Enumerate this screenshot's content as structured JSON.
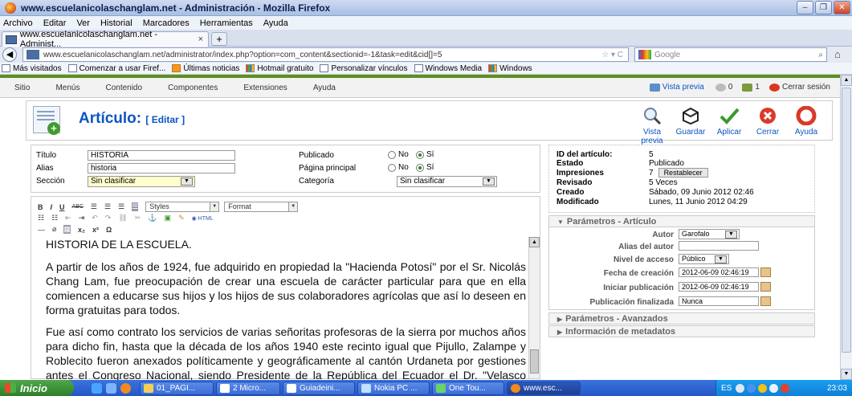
{
  "window": {
    "title": "www.escuelanicolaschanglam.net - Administración - Mozilla Firefox"
  },
  "menubar": [
    "Archivo",
    "Editar",
    "Ver",
    "Historial",
    "Marcadores",
    "Herramientas",
    "Ayuda"
  ],
  "tab": {
    "label": "www.escuelanicolaschanglam.net - Administ...",
    "close": "×",
    "new_tab": "+"
  },
  "address": {
    "url": "www.escuelanicolaschanglam.net/administrator/index.php?option=com_content&sectionid=-1&task=edit&cid[]=5",
    "search_placeholder": "Google"
  },
  "bookmarks": [
    "Más visitados",
    "Comenzar a usar Firef...",
    "Últimas noticias",
    "Hotmail gratuito",
    "Personalizar vínculos",
    "Windows Media",
    "Windows"
  ],
  "admin_menu": {
    "items": [
      "Sitio",
      "Menús",
      "Contenido",
      "Componentes",
      "Extensiones",
      "Ayuda"
    ],
    "preview": "Vista previa",
    "count_a": "0",
    "count_b": "1",
    "logout": "Cerrar sesión"
  },
  "header": {
    "title": "Artículo:",
    "subtitle": "[ Editar ]",
    "toolbar": [
      "Vista previa",
      "Guardar",
      "Aplicar",
      "Cerrar",
      "Ayuda"
    ]
  },
  "form": {
    "titulo_label": "Título",
    "titulo_value": "HISTORIA",
    "alias_label": "Alias",
    "alias_value": "historia",
    "seccion_label": "Sección",
    "seccion_value": "Sin clasificar",
    "publicado_label": "Publicado",
    "pagina_label": "Página principal",
    "categoria_label": "Categoría",
    "categoria_value": "Sin clasificar",
    "no": "No",
    "si": "Sí"
  },
  "editor": {
    "styles": "Styles",
    "format": "Format",
    "heading": "HISTORIA DE LA ESCUELA.",
    "p1": "A partir de los años de 1924, fue adquirido en propiedad la \"Hacienda Potosí\" por el Sr. Nicolás Chang Lam, fue preocupación de crear una escuela de carácter particular para que en ella comiencen a educarse sus hijos y los hijos de sus colaboradores agrícolas que así lo deseen en forma gratuitas para todos.",
    "p2": "Fue así como contrato los servicios de varias señoritas profesoras de la sierra por muchos años para dicho fin, hasta que la década de los años 1940 este recinto igual que Pijullo, Zalampe y Roblecito fueron anexados políticamente y geográficamente al cantón Urdaneta por gestiones antes el Congreso Nacional, siendo Presidente de la República del Ecuador el Dr. \"Velasco Ibarra\" habiéndoles tocado actuar con gran entusiasmo estas gestiones a los Señores"
  },
  "info": {
    "id_label": "ID del artículo:",
    "id_value": "5",
    "estado_label": "Estado",
    "estado_value": "Publicado",
    "impresiones_label": "Impresiones",
    "impresiones_value": "7",
    "reset": "Restablecer",
    "revisado_label": "Revisado",
    "revisado_value": "5 Veces",
    "creado_label": "Creado",
    "creado_value": "Sábado, 09 Junio 2012 02:46",
    "modificado_label": "Modificado",
    "modificado_value": "Lunes, 11 Junio 2012 04:29"
  },
  "params": {
    "title": "Parámetros - Artículo",
    "autor_label": "Autor",
    "autor_value": "Garofalo",
    "alias_autor_label": "Alias del autor",
    "nivel_label": "Nivel de acceso",
    "nivel_value": "Público",
    "fecha_label": "Fecha de creación",
    "fecha_value": "2012-06-09 02:46:19",
    "inicio_label": "Iniciar publicación",
    "inicio_value": "2012-06-09 02:46:19",
    "fin_label": "Publicación finalizada",
    "fin_value": "Nunca",
    "advanced": "Parámetros - Avanzados",
    "metadata": "Información de metadatos"
  },
  "taskbar": {
    "start": "Inicio",
    "items": [
      "01_PAGI...",
      "2 Micro...",
      "Guiadeini...",
      "Nokia PC ...",
      "One Tou...",
      "www.esc..."
    ],
    "lang": "ES",
    "clock": "23:03"
  }
}
